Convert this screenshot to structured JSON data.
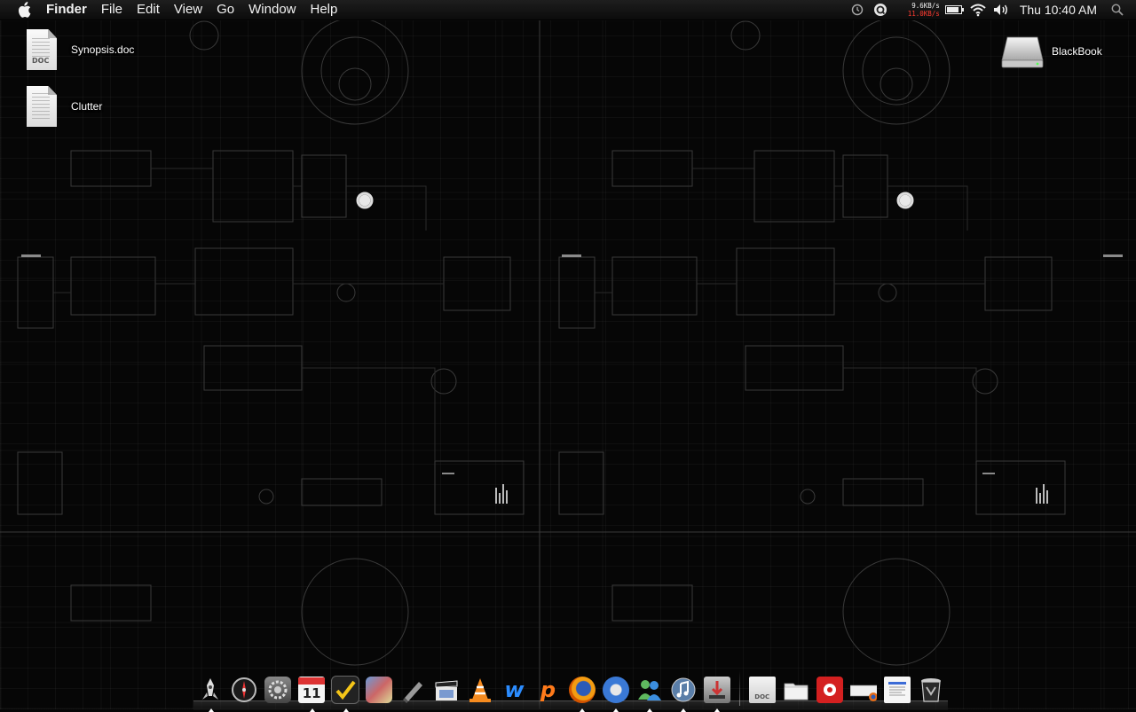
{
  "menubar": {
    "app_name": "Finder",
    "menus": [
      "File",
      "Edit",
      "View",
      "Go",
      "Window",
      "Help"
    ],
    "network": {
      "up": "9.6KB/s",
      "down": "11.0KB/s"
    },
    "clock": "Thu 10:40 AM"
  },
  "desktop": {
    "icons": [
      {
        "label": "Synopsis.doc",
        "tag": "DOC"
      },
      {
        "label": "Clutter"
      },
      {
        "label": "BlackBook"
      }
    ]
  },
  "dock": {
    "apps": [
      {
        "icon": "rocket-icon",
        "running": true
      },
      {
        "icon": "compass-icon",
        "running": false
      },
      {
        "icon": "system-preferences-icon",
        "running": false
      },
      {
        "icon": "calendar-icon",
        "running": true,
        "text": "11"
      },
      {
        "icon": "todo-checkmark-icon",
        "running": true
      },
      {
        "icon": "photo-app-icon",
        "running": false
      },
      {
        "icon": "script-editor-icon",
        "running": false
      },
      {
        "icon": "clapboard-icon",
        "running": false
      },
      {
        "icon": "vlc-cone-icon",
        "running": false
      },
      {
        "icon": "word-icon",
        "running": false
      },
      {
        "icon": "powerpoint-icon",
        "running": false
      },
      {
        "icon": "firefox-icon",
        "running": true
      },
      {
        "icon": "thunderbird-icon",
        "running": true
      },
      {
        "icon": "messenger-icon",
        "running": true
      },
      {
        "icon": "itunes-icon",
        "running": true
      },
      {
        "icon": "installer-icon",
        "running": true
      }
    ],
    "stacks": [
      {
        "icon": "doc-stack-icon"
      },
      {
        "icon": "folder-stack-icon"
      },
      {
        "icon": "red-app-icon"
      },
      {
        "icon": "window-firefox-stack-icon"
      },
      {
        "icon": "document-window-stack-icon"
      },
      {
        "icon": "trash-icon"
      }
    ]
  },
  "colors": {
    "background": "#060606",
    "net_down": "#ff3b30",
    "menubar": "#121212"
  }
}
